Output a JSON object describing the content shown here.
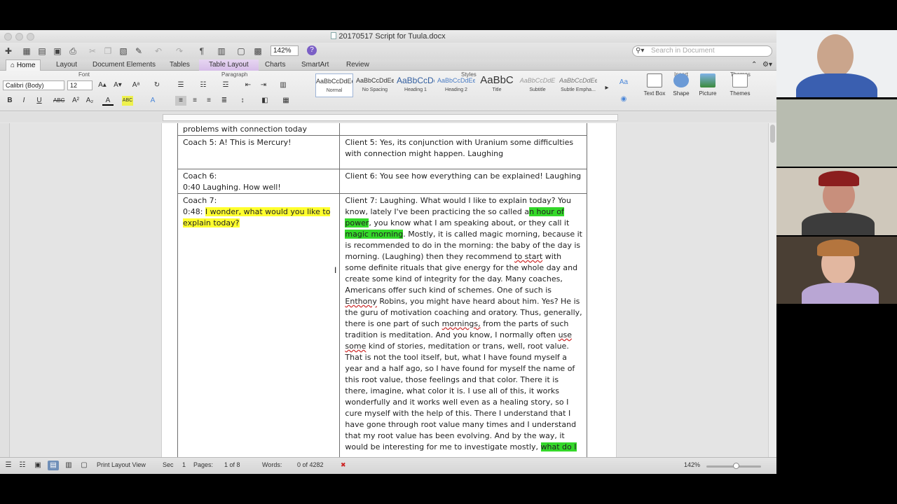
{
  "window": {
    "title": "20170517 Script for Tuula.docx"
  },
  "toolbar": {
    "zoom": "142%",
    "help": "?",
    "search_placeholder": "Search in Document"
  },
  "tabs": [
    "Home",
    "Layout",
    "Document Elements",
    "Tables",
    "Table Layout",
    "Charts",
    "SmartArt",
    "Review"
  ],
  "ribbon": {
    "groups": {
      "font": "Font",
      "paragraph": "Paragraph",
      "styles": "Styles",
      "insert": "Insert",
      "themes": "Themes"
    },
    "font_name": "Calibri (Body)",
    "font_size": "12",
    "styles": [
      {
        "sample": "AaBbCcDdEe",
        "label": "Normal"
      },
      {
        "sample": "AaBbCcDdEe",
        "label": "No Spacing"
      },
      {
        "sample": "AaBbCcDc",
        "label": "Heading 1"
      },
      {
        "sample": "AaBbCcDdEe",
        "label": "Heading 2"
      },
      {
        "sample": "AaBbC",
        "label": "Title"
      },
      {
        "sample": "AaBbCcDdE",
        "label": "Subtitle"
      },
      {
        "sample": "AaBbCcDdEe",
        "label": "Subtle Empha..."
      }
    ],
    "insert_items": [
      "Text Box",
      "Shape",
      "Picture"
    ],
    "themes_item": "Themes"
  },
  "document": {
    "rows": [
      {
        "coach": [
          [
            {
              "t": "problems with connection today"
            }
          ]
        ],
        "client": []
      },
      {
        "coach": [
          [
            {
              "t": "Coach 5: A! This is Mercury!"
            }
          ]
        ],
        "client": [
          [
            {
              "t": "Client 5: Yes, its conjunction with Uranium some difficulties"
            }
          ],
          [
            {
              "t": "with connection might happen. Laughing"
            }
          ]
        ]
      },
      {
        "coach": [
          [
            {
              "t": "Coach 6:"
            }
          ],
          [
            {
              "t": "0:40 Laughing. How well!"
            }
          ]
        ],
        "client": [
          [
            {
              "t": "Client 6: You see how everything can be explained! Laughing"
            }
          ]
        ]
      },
      {
        "coach": [
          [
            {
              "t": "Coach 7:"
            }
          ],
          [
            {
              "t": "0:48: "
            },
            {
              "t": "I wonder, what would you like to",
              "s": "hy"
            }
          ],
          [
            {
              "t": "explain today?",
              "s": "hy"
            }
          ]
        ],
        "client": [
          [
            {
              "t": "Client 7: Laughing. What would I like to explain today? You"
            }
          ],
          [
            {
              "t": "know, lately I've been practicing the so called a"
            },
            {
              "t": "n hour of",
              "s": "hg"
            }
          ],
          [
            {
              "t": "power",
              "s": "hg"
            },
            {
              "t": ", you know what I am speaking about, or they call it"
            }
          ],
          [
            {
              "t": "magic morning",
              "s": "hg"
            },
            {
              "t": ". Mostly, it is called magic morning, because it"
            }
          ],
          [
            {
              "t": "is recommended to do in the morning: the baby of the day is"
            }
          ],
          [
            {
              "t": "morning. (Laughing) then they recommend "
            },
            {
              "t": "to start",
              "s": "ul"
            },
            {
              "t": " with"
            }
          ],
          [
            {
              "t": "some definite rituals that give energy for the whole day and"
            }
          ],
          [
            {
              "t": "create some kind of integrity for the day. Many coaches,"
            }
          ],
          [
            {
              "t": "Americans offer such kind of schemes. One of such is"
            }
          ],
          [
            {
              "t": "Enthony",
              "s": "ul"
            },
            {
              "t": " Robins, you might have heard about him. Yes? He is"
            }
          ],
          [
            {
              "t": "the guru of motivation coaching and oratory. Thus, generally,"
            }
          ],
          [
            {
              "t": "there is one part of such "
            },
            {
              "t": "mornings,",
              "s": "ul"
            },
            {
              "t": " from the parts of such"
            }
          ],
          [
            {
              "t": "tradition is meditation. And you know, I normally often "
            },
            {
              "t": "use",
              "s": "ul"
            }
          ],
          [
            {
              "t": "some",
              "s": "ul"
            },
            {
              "t": " kind of stories, meditation or trans, well, root value."
            }
          ],
          [
            {
              "t": "That is not the tool itself, but, what I have found myself a"
            }
          ],
          [
            {
              "t": "year and a half ago, so I have found for myself the name of"
            }
          ],
          [
            {
              "t": "this root value, those feelings and that color. There it is"
            }
          ],
          [
            {
              "t": "there, imagine, what color it is. I use all of this, it works"
            }
          ],
          [
            {
              "t": "wonderfully and it works well even as a healing story, so I"
            }
          ],
          [
            {
              "t": "cure myself with the help of this. There I understand that I"
            }
          ],
          [
            {
              "t": "have gone through root value many times and I understand"
            }
          ],
          [
            {
              "t": "that my root value has been evolving. And by the way, it"
            }
          ],
          [
            {
              "t": "would be interesting for me to investigate mostly, "
            },
            {
              "t": "what do I",
              "s": "hg"
            }
          ]
        ]
      }
    ]
  },
  "statusbar": {
    "view": "Print Layout View",
    "sec_label": "Sec",
    "sec_value": "1",
    "pages_label": "Pages:",
    "pages_value": "1 of 8",
    "words_label": "Words:",
    "words_value": "0 of 4282",
    "zoom": "142%"
  },
  "colors": {
    "highlight_yellow": "#ffff2e",
    "highlight_green": "#34d82a",
    "table_layout_tab": "#d6bde8",
    "help_icon": "#7b5fc6"
  }
}
